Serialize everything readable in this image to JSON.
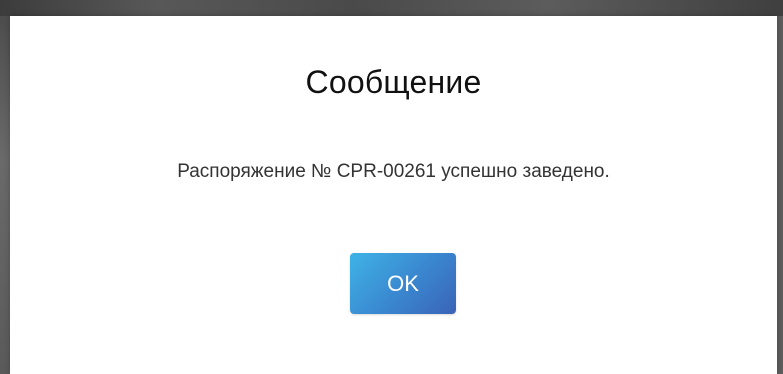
{
  "dialog": {
    "title": "Сообщение",
    "message": "Распоряжение № CPR-00261 успешно заведено.",
    "ok_label": "OK"
  },
  "colors": {
    "button_gradient_start": "#3fb3e6",
    "button_gradient_end": "#3a63b6",
    "title_text": "#111111",
    "message_text": "#333333"
  }
}
